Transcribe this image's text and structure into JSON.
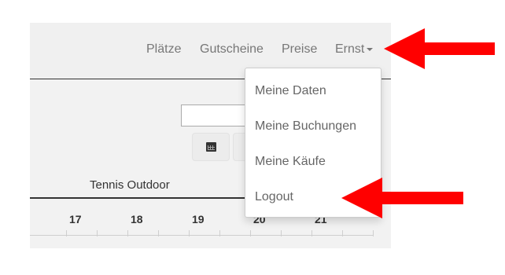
{
  "navbar": {
    "items": [
      {
        "label": "Plätze"
      },
      {
        "label": "Gutscheine"
      },
      {
        "label": "Preise"
      }
    ],
    "user_menu_label": "Ernst"
  },
  "dropdown": {
    "items": [
      {
        "label": "Meine Daten"
      },
      {
        "label": "Meine Buchungen"
      },
      {
        "label": "Meine Käufe"
      },
      {
        "label": "Logout"
      }
    ]
  },
  "main": {
    "date_value": "",
    "calendar_icon": "calendar-icon",
    "section_title": "Tennis Outdoor",
    "columns": [
      "17",
      "18",
      "19",
      "20",
      "21"
    ]
  },
  "annotations": {
    "arrow_color": "#ff0000",
    "arrow_targets": [
      "Ernst",
      "Logout"
    ]
  }
}
